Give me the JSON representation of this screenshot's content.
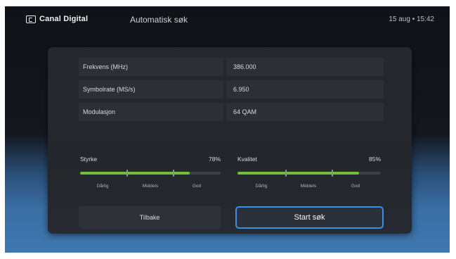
{
  "header": {
    "brand": "Canal Digital",
    "title": "Automatisk søk",
    "datetime": "15 aug • 15:42"
  },
  "fields": [
    {
      "label": "Frekvens (MHz)",
      "value": "386.000"
    },
    {
      "label": "Symbolrate (MS/s)",
      "value": "6.950"
    },
    {
      "label": "Modulasjon",
      "value": "64 QAM"
    }
  ],
  "meters": [
    {
      "label": "Styrke",
      "percent_label": "78%",
      "level": 0.78,
      "scale": [
        "Dårlig",
        "Middels",
        "God"
      ]
    },
    {
      "label": "Kvalitet",
      "percent_label": "85%",
      "level": 0.85,
      "scale": [
        "Dårlig",
        "Middels",
        "God"
      ]
    }
  ],
  "buttons": {
    "back_label": "Tilbake",
    "start_label": "Start søk"
  },
  "colors": {
    "accent_focus": "#3a8ee6",
    "meter_fill": "#6ec03b",
    "panel_bg": "#24282d"
  }
}
